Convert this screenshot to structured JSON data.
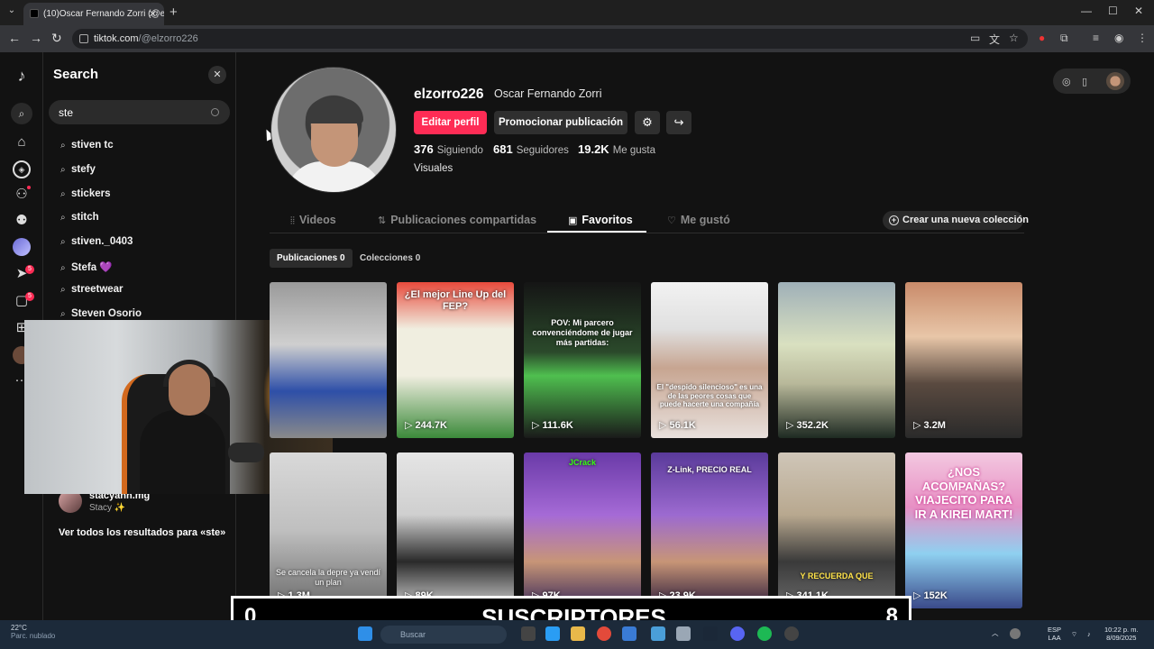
{
  "browser": {
    "tab_title": "(10)Oscar Fernando Zorri (@elz",
    "url_host": "tiktok.com",
    "url_path": "/@elzorro226",
    "new_tab": "+",
    "close": "✕",
    "back": "←",
    "forward": "→",
    "reload": "↻",
    "minimize": "—",
    "maximize": "☐",
    "window_close": "✕"
  },
  "rail": {
    "logo": "♪",
    "inbox_badge": "5",
    "messages_badge": "5",
    "more": "···"
  },
  "search": {
    "title": "Search",
    "close": "✕",
    "value": "ste",
    "suggestions": [
      "stiven tc",
      "stefy",
      "stickers",
      "stitch",
      "stiven._0403",
      "Stefa 💜",
      "streetwear",
      "Steven Osorio"
    ],
    "account": {
      "name": "stacyahh.mg",
      "sub": "Stacy ✨"
    },
    "see_all": "Ver todos los resultados para «ste»"
  },
  "profile": {
    "username": "elzorro226",
    "display_name": "Oscar Fernando Zorri",
    "edit_label": "Editar perfil",
    "promote_label": "Promocionar publicación",
    "settings_icon": "⚙",
    "share_icon": "↪",
    "following_count": "376",
    "following_label": "Siguiendo",
    "followers_count": "681",
    "followers_label": "Seguidores",
    "likes_count": "19.2K",
    "likes_label": "Me gusta",
    "bio": "Visuales"
  },
  "tabs": {
    "videos": "Videos",
    "reposts": "Publicaciones compartidas",
    "favorites": "Favoritos",
    "liked": "Me gustó",
    "create_collection": "Crear una nueva colección",
    "sub_posts": "Publicaciones 0",
    "sub_collections": "Colecciones 0"
  },
  "grid": [
    {
      "views": "",
      "caption": ""
    },
    {
      "views": "▷ 244.7K",
      "caption": "¿El mejor Line Up del FEP?"
    },
    {
      "views": "▷ 111.6K",
      "caption": "POV: Mi parcero convenciéndome de jugar más partidas:"
    },
    {
      "views": "▷ 56.1K",
      "caption": "El \"despido silencioso\" es una de las peores cosas que puede hacerte una compañía"
    },
    {
      "views": "▷ 352.2K",
      "caption": ""
    },
    {
      "views": "▷ 3.2M",
      "caption": ""
    },
    {
      "views": "▷ 1.3M",
      "caption": "Se cancela la depre ya vendí un plan"
    },
    {
      "views": "▷ 89K",
      "caption": ""
    },
    {
      "views": "▷ 97K",
      "caption": "JCrack"
    },
    {
      "views": "▷ 23.9K",
      "caption": "Z-Link, PRECIO REAL"
    },
    {
      "views": "▷ 341.1K",
      "caption": "Y RECUERDA QUE"
    },
    {
      "views": "▷ 152K",
      "caption": "¿NOS ACOMPAÑAS? VIAJECITO PARA IR A KIREI MART!"
    }
  ],
  "overlay": {
    "left": "0",
    "center": "SUSCRIPTORES",
    "right": "8"
  },
  "taskbar": {
    "temp": "22°C",
    "weather": "Parc. nublado",
    "search_placeholder": "Buscar",
    "lang_top": "ESP",
    "lang_bottom": "LAA",
    "time": "10:22 p. m.",
    "date": "8/09/2025",
    "notif_badge": "4"
  }
}
